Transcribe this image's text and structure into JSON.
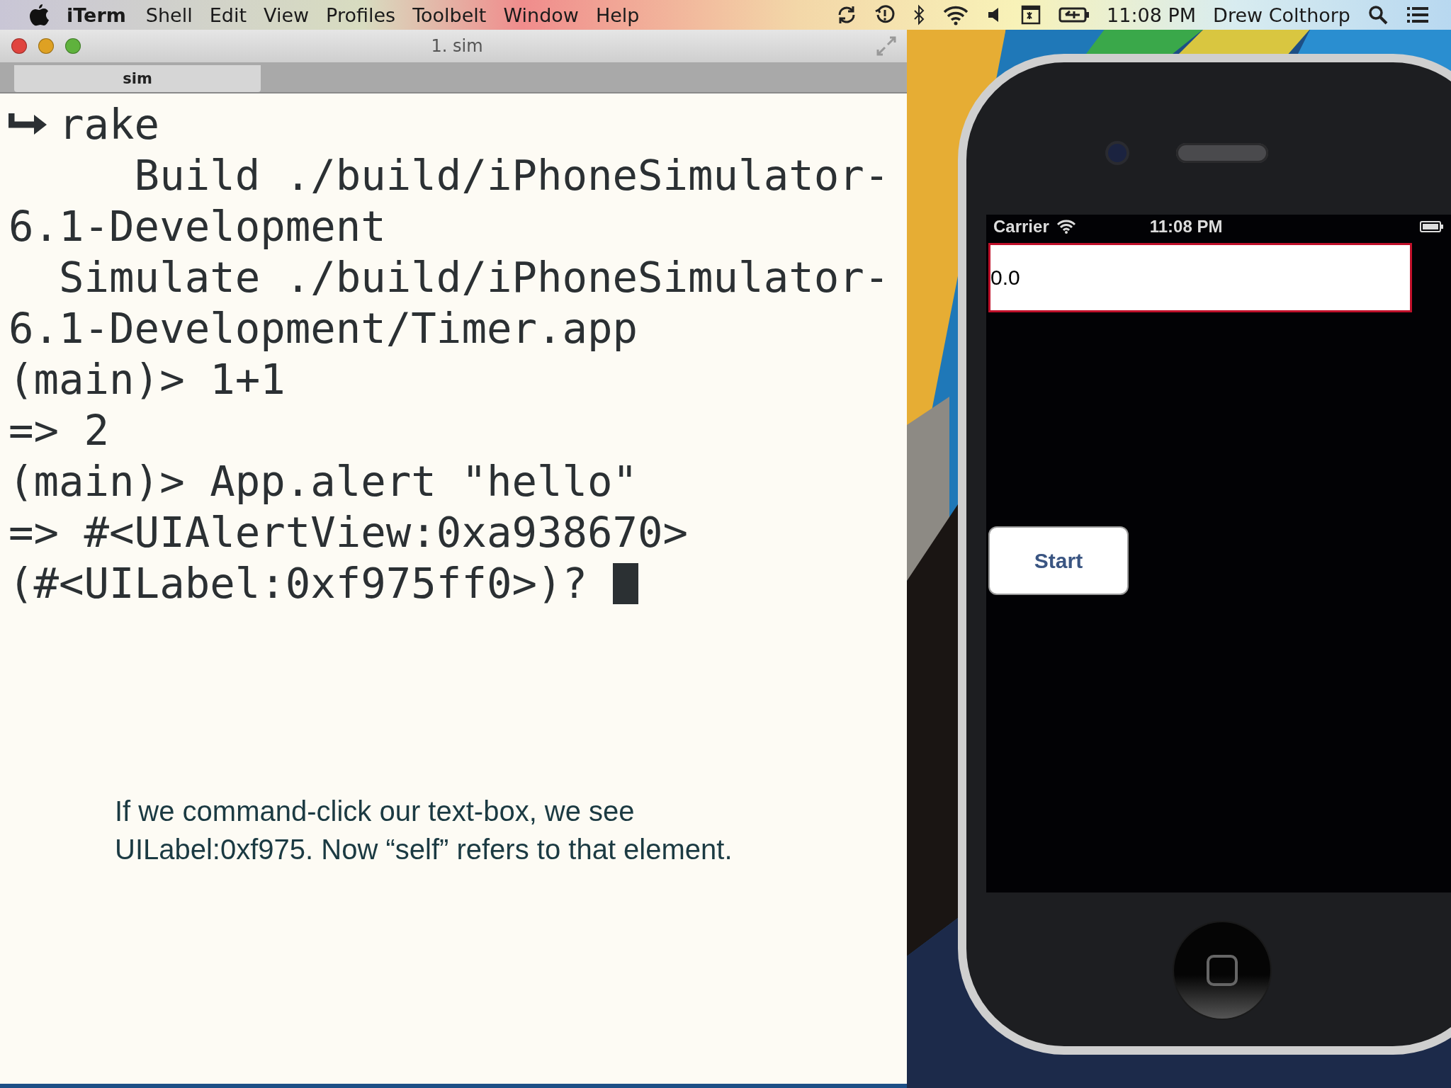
{
  "menu_bar": {
    "app": "iTerm",
    "menus": [
      "Shell",
      "Edit",
      "View",
      "Profiles",
      "Toolbelt",
      "Window",
      "Help"
    ],
    "clock": "11:08 PM",
    "user": "Drew Colthorp"
  },
  "terminal": {
    "title": "1. sim",
    "tabs": [
      {
        "label": "sim",
        "selected": true
      }
    ],
    "lines": [
      {
        "text": "rake",
        "prompt": true,
        "cursor": false
      },
      {
        "text": "     Build ./build/iPhoneSimulator-",
        "prompt": false,
        "cursor": false
      },
      {
        "text": "6.1-Development",
        "prompt": false,
        "cursor": false
      },
      {
        "text": "  Simulate ./build/iPhoneSimulator-",
        "prompt": false,
        "cursor": false
      },
      {
        "text": "6.1-Development/Timer.app",
        "prompt": false,
        "cursor": false
      },
      {
        "text": "(main)> 1+1",
        "prompt": false,
        "cursor": false
      },
      {
        "text": "=> 2",
        "prompt": false,
        "cursor": false
      },
      {
        "text": "(main)> App.alert \"hello\"",
        "prompt": false,
        "cursor": false
      },
      {
        "text": "=> #<UIAlertView:0xa938670>",
        "prompt": false,
        "cursor": false
      },
      {
        "text": "(#<UILabel:0xf975ff0>)? ",
        "prompt": false,
        "cursor": true
      }
    ],
    "caption": [
      "If we command-click our text-box, we see",
      "UILabel:0xf975. Now “self” refers to that element."
    ]
  },
  "simulator": {
    "carrier": "Carrier",
    "time": "11:08 PM",
    "label": "0.0",
    "button": "Start"
  }
}
